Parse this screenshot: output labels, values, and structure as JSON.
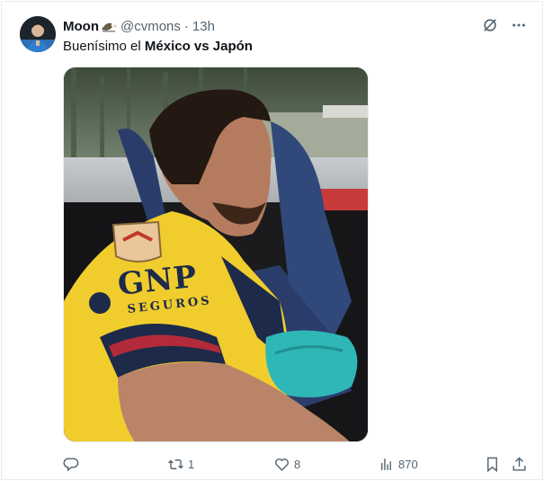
{
  "tweet": {
    "author_name": "Moon",
    "author_emoji": "eagle-emoji",
    "handle": "@cvmons",
    "separator": "·",
    "time": "13h",
    "text_prefix": "Buenísimo el ",
    "text_bold": "México vs Japón",
    "media": {
      "jersey_sponsor": "GNP",
      "jersey_sponsor_sub": "SEGUROS"
    }
  },
  "actions": {
    "reply_count": "",
    "retweet_count": "1",
    "like_count": "8",
    "views_count": "870"
  },
  "icons": {
    "more": "more-icon",
    "grok": "grok-icon",
    "reply": "reply-icon",
    "retweet": "retweet-icon",
    "like": "heart-icon",
    "views": "views-icon",
    "bookmark": "bookmark-icon",
    "share": "share-icon"
  },
  "colors": {
    "text": "#0f1419",
    "secondary": "#536471",
    "jersey_yellow": "#f0cd2d",
    "jersey_navy": "#1e2a4a",
    "teal_cloth": "#2fb7b8"
  }
}
